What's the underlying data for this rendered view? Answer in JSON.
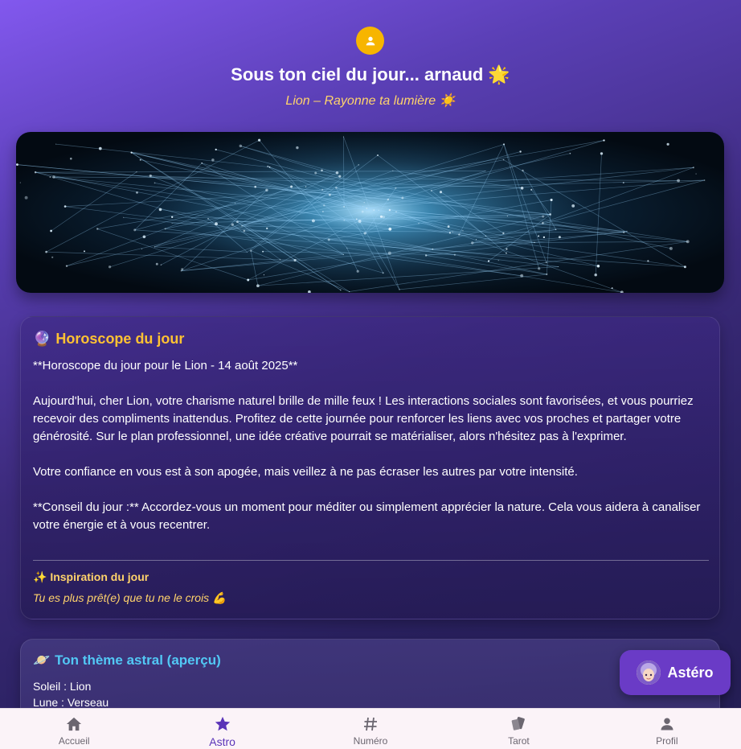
{
  "header": {
    "greeting": "Sous ton ciel du jour... arnaud 🌟",
    "subtitle": "Lion – Rayonne ta lumière ☀️"
  },
  "horoscope": {
    "icon": "🔮",
    "title": "Horoscope du jour",
    "text": "**Horoscope du jour pour le Lion - 14 août 2025**\n\nAujourd'hui, cher Lion, votre charisme naturel brille de mille feux ! Les interactions sociales sont favorisées, et vous pourriez recevoir des compliments inattendus. Profitez de cette journée pour renforcer les liens avec vos proches et partager votre générosité. Sur le plan professionnel, une idée créative pourrait se matérialiser, alors n'hésitez pas à l'exprimer.\n\nVotre confiance en vous est à son apogée, mais veillez à ne pas écraser les autres par votre intensité.\n\n**Conseil du jour :** Accordez-vous un moment pour méditer ou simplement apprécier la nature. Cela vous aidera à canaliser votre énergie et à vous recentrer.",
    "inspiration_title": "✨ Inspiration du jour",
    "inspiration_text": "Tu es plus prêt(e) que tu ne le crois 💪"
  },
  "astral": {
    "icon": "🪐",
    "title": "Ton thème astral (aperçu)",
    "soleil": "Soleil : Lion",
    "lune": "Lune : Verseau"
  },
  "fab": {
    "label": "Astéro"
  },
  "nav": {
    "items": [
      {
        "label": "Accueil",
        "icon": "home-icon"
      },
      {
        "label": "Astro",
        "icon": "star-icon"
      },
      {
        "label": "Numéro",
        "icon": "hash-icon"
      },
      {
        "label": "Tarot",
        "icon": "cards-icon"
      },
      {
        "label": "Profil",
        "icon": "person-icon"
      }
    ],
    "active": "Astro"
  },
  "colors": {
    "accent": "#5a34b8",
    "gold": "#ffc233",
    "cyan": "#52c8f5",
    "avatar": "#f7b500"
  }
}
